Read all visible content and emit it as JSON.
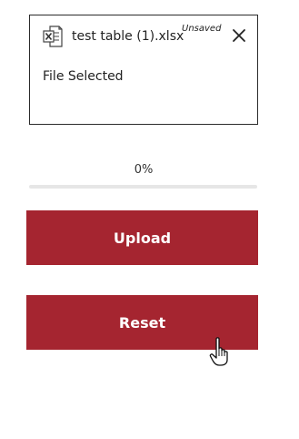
{
  "file_card": {
    "file_name": "test table (1).xlsx",
    "unsaved_label": "Unsaved",
    "status": "File Selected",
    "icon": "excel-file-icon",
    "close_icon": "close-icon"
  },
  "progress": {
    "label": "0%",
    "value": 0
  },
  "actions": {
    "upload_label": "Upload",
    "reset_label": "Reset"
  },
  "colors": {
    "accent": "#a52530",
    "track": "#e6e6e6",
    "border": "#2b2b2b"
  },
  "cursor": "hand-pointer-icon"
}
